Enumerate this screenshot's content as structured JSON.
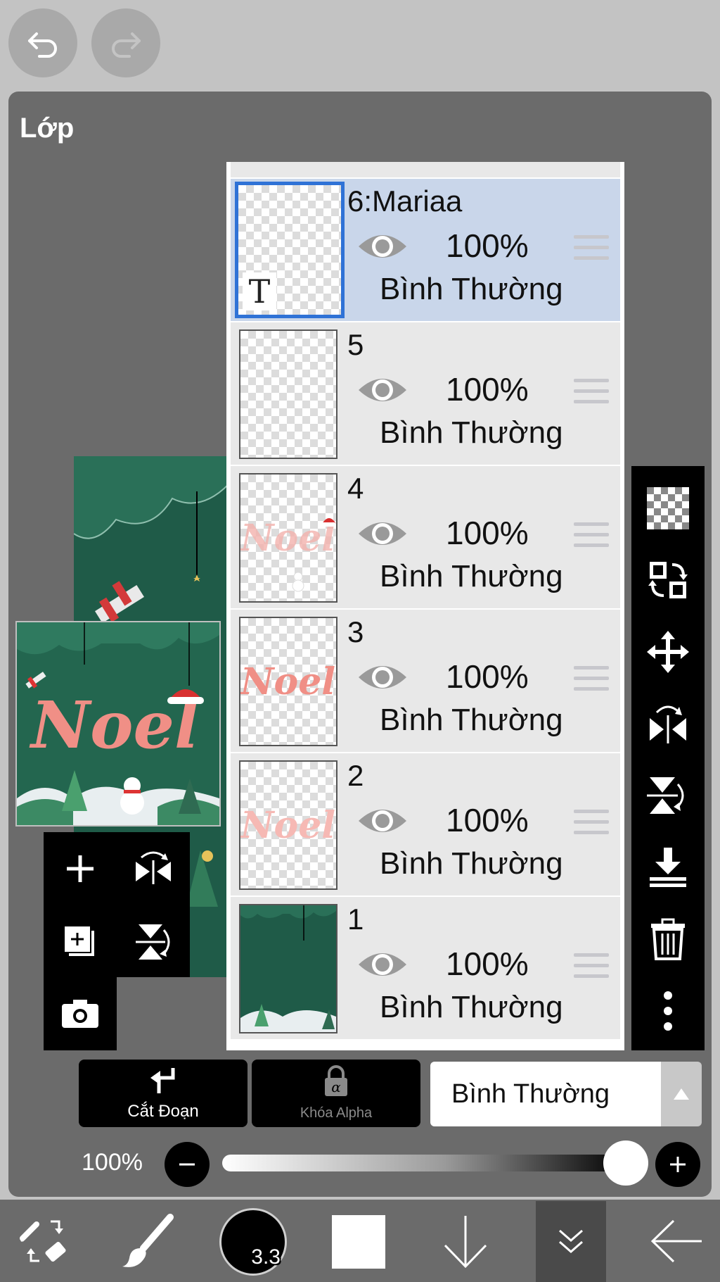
{
  "panel": {
    "title": "Lớp"
  },
  "layers": [
    {
      "name": "6:Mariaa",
      "opacity": "100%",
      "blend": "Bình Thường",
      "thumb": "text",
      "selected": true
    },
    {
      "name": "5",
      "opacity": "100%",
      "blend": "Bình Thường",
      "thumb": "empty",
      "selected": false
    },
    {
      "name": "4",
      "opacity": "100%",
      "blend": "Bình Thường",
      "thumb": "noel-faint",
      "selected": false
    },
    {
      "name": "3",
      "opacity": "100%",
      "blend": "Bình Thường",
      "thumb": "noel",
      "selected": false
    },
    {
      "name": "2",
      "opacity": "100%",
      "blend": "Bình Thường",
      "thumb": "noel-light",
      "selected": false
    },
    {
      "name": "1",
      "opacity": "100%",
      "blend": "Bình Thường",
      "thumb": "background",
      "selected": false
    }
  ],
  "thumb_text_glyph": "T",
  "actions": {
    "clipping_label": "Cắt Đoạn",
    "alpha_lock_label": "Khóa Alpha",
    "blend_mode": "Bình Thường"
  },
  "opacity": {
    "label": "100%",
    "value": 1.0
  },
  "brush": {
    "size": "3.3"
  },
  "colors": {
    "primary": "#ffffff",
    "selected_row": "#c9d6ea",
    "selected_border": "#2f72d6"
  }
}
